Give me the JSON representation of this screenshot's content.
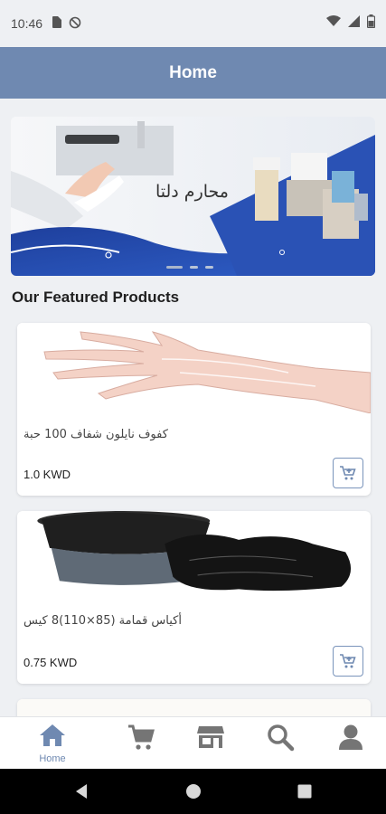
{
  "status_bar": {
    "time": "10:46"
  },
  "app_bar": {
    "title": "Home"
  },
  "banner": {
    "overlay_text": "محارم دلتا",
    "slide_count": 3,
    "active_slide": 1
  },
  "featured": {
    "title": "Our Featured Products",
    "products": [
      {
        "name": "كفوف نايلون شفاف 100 حبة",
        "price": "1.0 KWD"
      },
      {
        "name": "أكياس قمامة (85×110)8 كيس",
        "price": "0.75 KWD"
      }
    ]
  },
  "bottom_nav": {
    "active": "home",
    "items": [
      {
        "id": "home",
        "label": "Home",
        "icon": "home-icon"
      },
      {
        "id": "cart",
        "label": "",
        "icon": "cart-icon"
      },
      {
        "id": "store",
        "label": "",
        "icon": "store-icon"
      },
      {
        "id": "search",
        "label": "",
        "icon": "search-icon"
      },
      {
        "id": "profile",
        "label": "",
        "icon": "user-icon"
      }
    ]
  },
  "colors": {
    "accent": "#6f89b1",
    "icon_gray": "#757575",
    "background": "#eef0f3"
  }
}
